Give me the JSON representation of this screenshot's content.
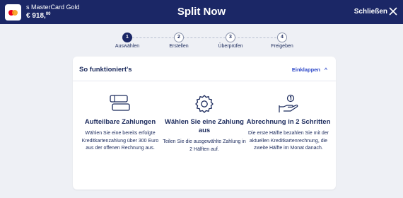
{
  "header": {
    "card_name": "s MasterCard Gold",
    "balance_main": "€ 918,",
    "balance_cents": "00",
    "title": "Split Now",
    "close_label": "Schließen"
  },
  "steps": [
    {
      "number": "1",
      "label": "Auswählen",
      "active": true
    },
    {
      "number": "2",
      "label": "Erstellen",
      "active": false
    },
    {
      "number": "3",
      "label": "Überprüfen",
      "active": false
    },
    {
      "number": "4",
      "label": "Freigeben",
      "active": false
    }
  ],
  "panel": {
    "title": "So funktioniert's",
    "collapse_label": "Einklappen",
    "features": [
      {
        "icon": "cards-icon",
        "title": "Aufteilbare Zahlungen",
        "text": "Wählen Sie eine bereits erfolgte Kreditkartenzahlung über 300 Euro aus der offenen Rechnung aus."
      },
      {
        "icon": "gear-icon",
        "title": "Wählen Sie eine Zahlung aus",
        "text": "Teilen Sie die ausgewählte Zahlung in 2 Hälften auf."
      },
      {
        "icon": "hand-coins-icon",
        "title": "Abrechnung in 2 Schritten",
        "text": "Die erste Hälfte bezahlen Sie mit der aktuellen Kreditkartenrechnung, die zweite Hälfte im Monat danach."
      }
    ]
  },
  "colors": {
    "header_bg": "#1b2766",
    "accent": "#2b46c8",
    "page_bg": "#eef0f5"
  }
}
